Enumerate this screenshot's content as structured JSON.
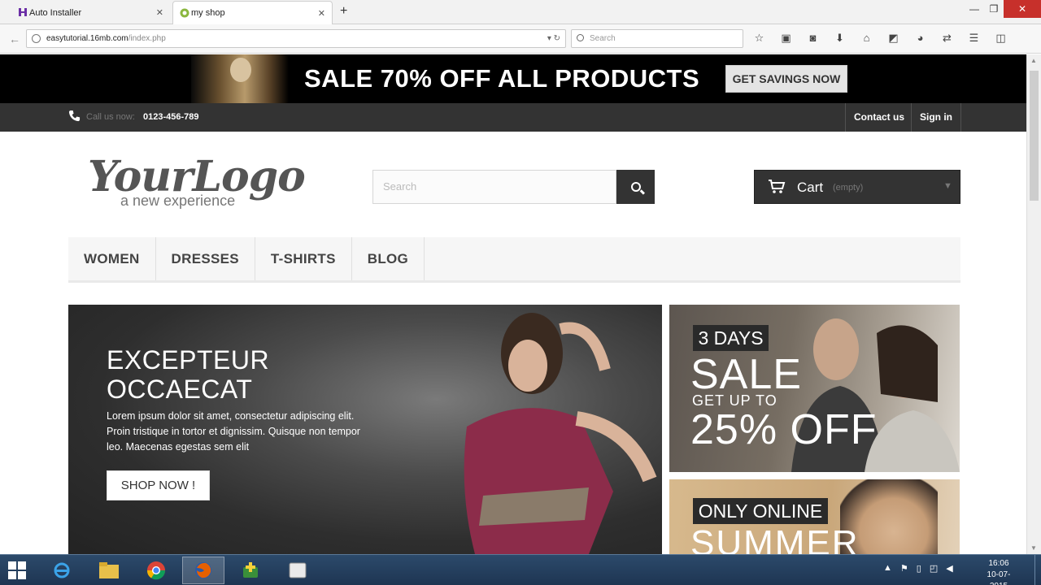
{
  "browser": {
    "tabs": [
      {
        "title": "Auto Installer",
        "icon": "hostinger-icon",
        "active": false
      },
      {
        "title": "my shop",
        "icon": "prestashop-icon",
        "active": true
      }
    ],
    "new_tab_label": "+",
    "url_host": "easytutorial.16mb.com",
    "url_path": "/index.php",
    "search_placeholder": "Search",
    "toolbar_icons": [
      "star-icon",
      "clipboard-icon",
      "pocket-icon",
      "download-icon",
      "home-icon",
      "screenshot-icon",
      "chat-icon",
      "sync-icon",
      "menu-icon",
      "profile-icon"
    ]
  },
  "promo": {
    "text": "SALE 70% OFF ALL PRODUCTS",
    "button": "GET SAVINGS NOW"
  },
  "topbar": {
    "call_label": "Call us now:",
    "phone": "0123-456-789",
    "contact": "Contact us",
    "signin": "Sign in"
  },
  "logo": {
    "main": "YourLogo",
    "tagline": "a new experience"
  },
  "shop_search": {
    "placeholder": "Search"
  },
  "cart": {
    "label": "Cart",
    "status": "(empty)"
  },
  "menu": [
    "WOMEN",
    "DRESSES",
    "T-SHIRTS",
    "BLOG"
  ],
  "hero": {
    "title_line1": "EXCEPTEUR",
    "title_line2": "OCCAECAT",
    "body": "Lorem ipsum dolor sit amet, consectetur adipiscing elit. Proin tristique in tortor et dignissim. Quisque non tempor leo. Maecenas egestas sem elit",
    "button": "SHOP NOW !"
  },
  "side_banner_1": {
    "badge": "3 DAYS",
    "headline": "SALE",
    "sub": "GET UP TO",
    "offer": "25% OFF"
  },
  "side_banner_2": {
    "badge": "ONLY ONLINE",
    "headline": "SUMMER"
  },
  "taskbar": {
    "apps": [
      "internet-explorer-icon",
      "file-explorer-icon",
      "chrome-icon",
      "firefox-icon",
      "installer-icon",
      "window-icon"
    ],
    "time": "16:06",
    "date": "10-07-2015"
  },
  "colors": {
    "topbar": "#333333",
    "promo_bg": "#000000",
    "button_dark": "#333333",
    "taskbar": "#1e3552"
  }
}
